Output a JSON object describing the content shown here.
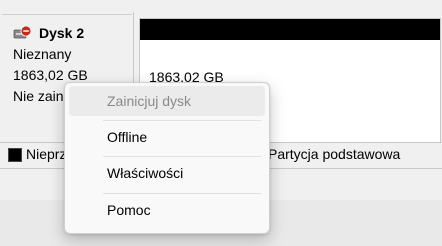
{
  "disk": {
    "title": "Dysk 2",
    "type": "Nieznany",
    "size": "1863,02 GB",
    "status": "Nie zainicjowany"
  },
  "partition": {
    "size": "1863,02 GB"
  },
  "legend": {
    "unallocated_label": "Nieprzydzielone",
    "primary_label": "Partycja podstawowa"
  },
  "context_menu": {
    "items": [
      {
        "label": "Zainicjuj dysk",
        "disabled": true
      },
      {
        "label": "Offline"
      },
      {
        "label": "Właściwości"
      },
      {
        "label": "Pomoc"
      }
    ]
  },
  "colors": {
    "unallocated": "#000000",
    "disk_error_icon": "#c42b1c"
  },
  "icons": {
    "disk_status": "disk-error-icon"
  }
}
